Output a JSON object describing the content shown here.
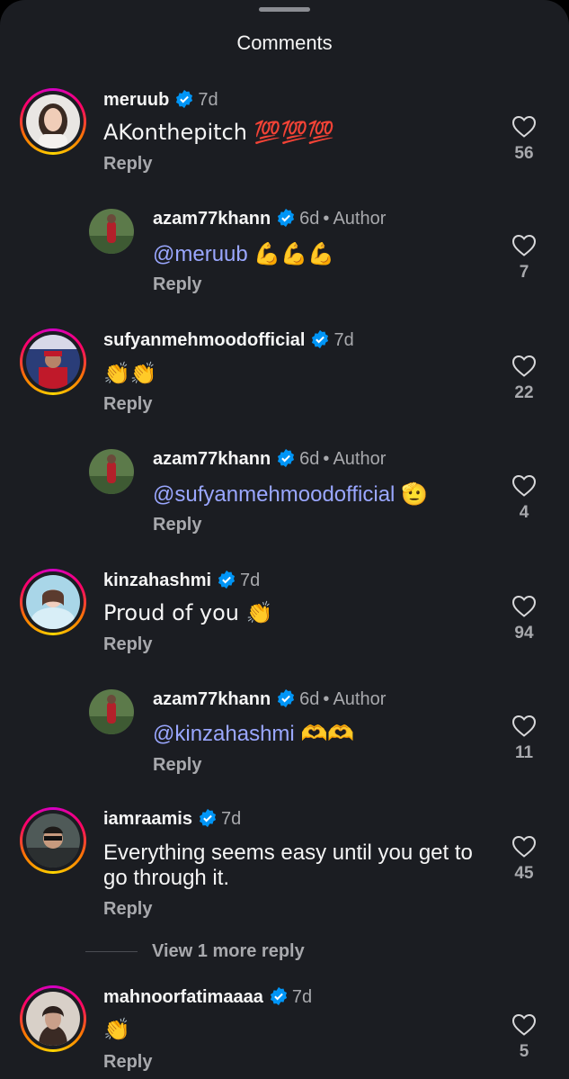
{
  "header": {
    "title": "Comments"
  },
  "reply_label": "Reply",
  "author_label": "Author",
  "comments": [
    {
      "username": "meruub",
      "time": "7d",
      "text": "AKonthepitch 💯💯💯",
      "likes": "56",
      "level": 0
    },
    {
      "username": "azam77khann",
      "time": "6d",
      "mention": "@meruub",
      "text": "💪💪💪",
      "likes": "7",
      "level": 1,
      "is_author": true
    },
    {
      "username": "sufyanmehmoodofficial",
      "time": "7d",
      "text": "👏👏",
      "likes": "22",
      "level": 0
    },
    {
      "username": "azam77khann",
      "time": "6d",
      "mention": "@sufyanmehmoodofficial",
      "text": "🫡",
      "likes": "4",
      "level": 1,
      "is_author": true
    },
    {
      "username": "kinzahashmi",
      "time": "7d",
      "text": "Proud of you 👏",
      "likes": "94",
      "level": 0
    },
    {
      "username": "azam77khann",
      "time": "6d",
      "mention": "@kinzahashmi",
      "text": "🫶🫶",
      "likes": "11",
      "level": 1,
      "is_author": true
    },
    {
      "username": "iamraamis",
      "time": "7d",
      "text": "Everything seems easy until you get to go through it.",
      "likes": "45",
      "level": 0
    },
    {
      "username": "mahnoorfatimaaaa",
      "time": "7d",
      "text": "👏",
      "likes": "5",
      "level": 0
    }
  ],
  "view_more": "View 1 more reply",
  "colors": {
    "background": "#1b1d22",
    "mention": "#9aa7ff",
    "verified": "#0095f6",
    "muted": "#a8a9ad"
  }
}
